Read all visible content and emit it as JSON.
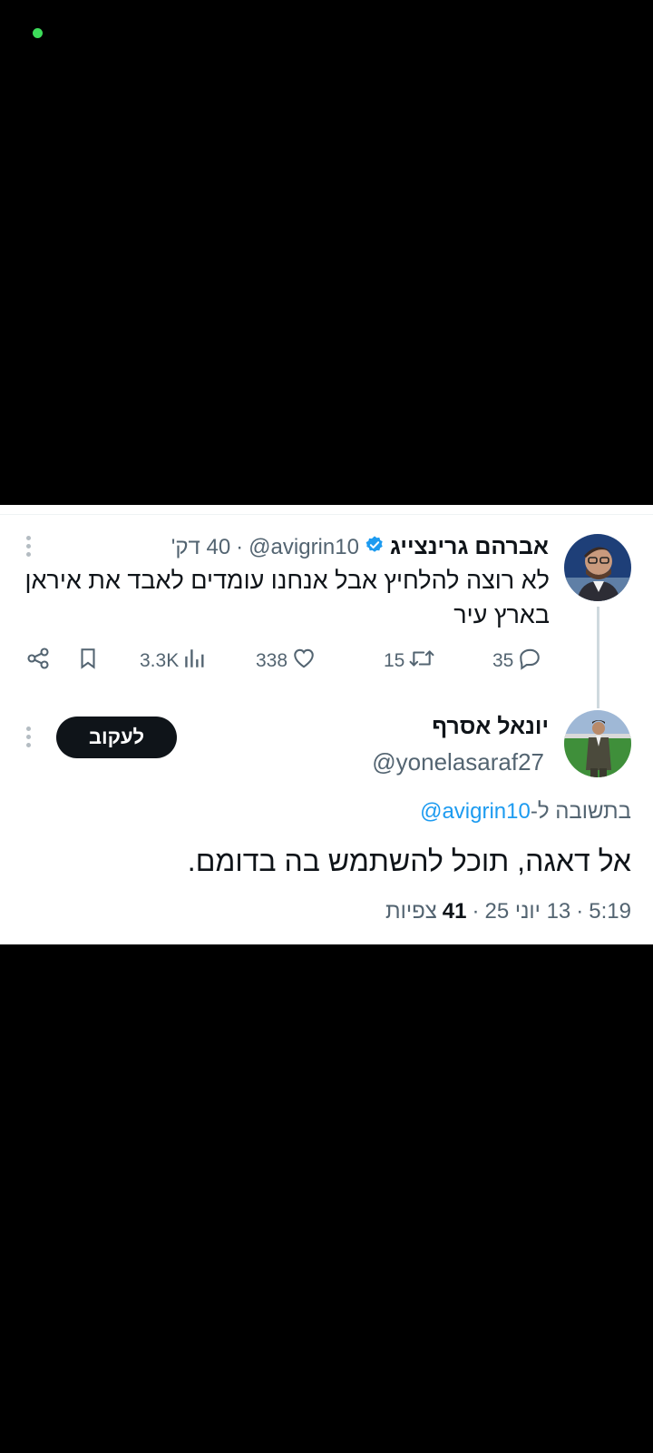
{
  "colors": {
    "accent": "#1d9bf0",
    "follow_bg": "#0f1419",
    "status_dot": "#3ddc5a",
    "text": "#0f1419",
    "muted": "#536471"
  },
  "original_tweet": {
    "author_name": "אברהם גרינצייג",
    "verified_icon": "verified-badge-icon",
    "handle": "@avigrin10",
    "separator": "·",
    "time": "40 דק'",
    "text_line1": "לא רוצה להלחיץ אבל אנחנו עומדים לאבד את איראן",
    "text_line2": "בארץ עיר",
    "stats": {
      "replies": "35",
      "retweets": "15",
      "likes": "338",
      "views": "3.3K"
    },
    "icons": [
      "reply-icon",
      "retweet-icon",
      "like-icon",
      "views-icon",
      "bookmark-icon",
      "share-icon",
      "more-icon"
    ]
  },
  "reply_tweet": {
    "author_name": "יונאל אסרף",
    "handle": "@yonelasaraf27",
    "follow_label": "לעקוב",
    "replying_to_prefix": "בתשובה ל-",
    "replying_to_handle": "@avigrin10",
    "text": "אל דאגה, תוכל להשתמש בה בדומם.",
    "time": "5:19",
    "sep1": "·",
    "date": "13 יוני 25",
    "sep2": "·",
    "views_count": "41",
    "views_label": "צפיות"
  }
}
